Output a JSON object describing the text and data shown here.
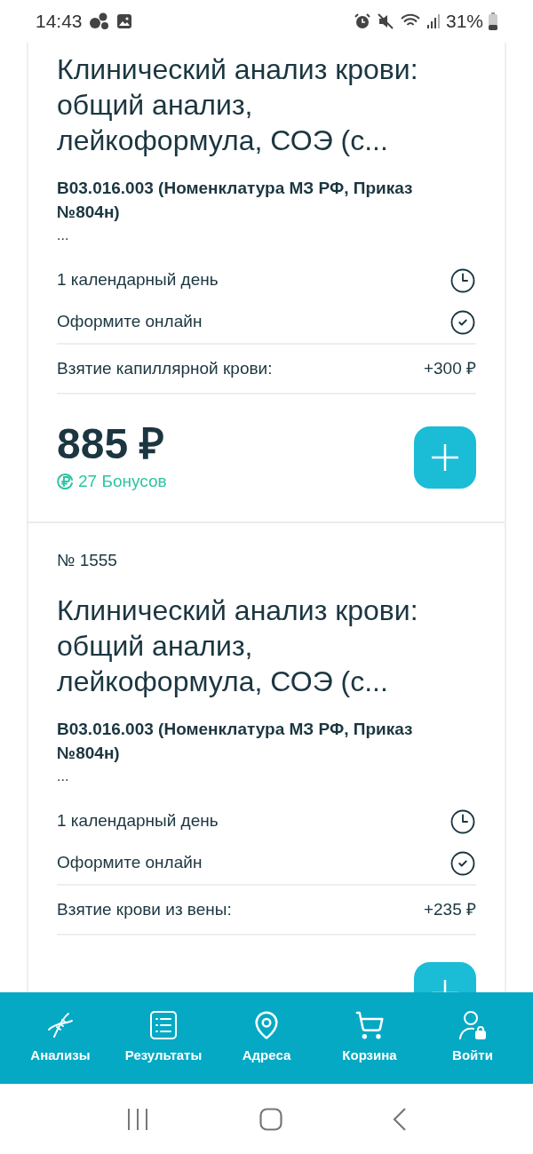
{
  "status_bar": {
    "time": "14:43",
    "battery": "31%"
  },
  "cards": [
    {
      "title": "Клинический анализ крови: общий анализ, лейкоформула, СОЭ (с...",
      "code": "B03.016.003 (Номенклатура МЗ РФ, Приказ №804н)",
      "more": "...",
      "info": [
        {
          "kind": "duration",
          "text": "1 календарный день"
        },
        {
          "kind": "online",
          "text": "Оформите онлайн"
        }
      ],
      "extra": {
        "label": "Взятие капиллярной крови:",
        "price": "+300 ₽"
      },
      "price": "885 ₽",
      "bonus": "27 Бонусов"
    },
    {
      "number": "№ 1555",
      "title": "Клинический анализ крови: общий анализ, лейкоформула, СОЭ (с...",
      "code": "B03.016.003 (Номенклатура МЗ РФ, Приказ №804н)",
      "more": "...",
      "info": [
        {
          "kind": "duration",
          "text": "1 календарный день"
        },
        {
          "kind": "online",
          "text": "Оформите онлайн"
        }
      ],
      "extra": {
        "label": "Взятие крови из вены:",
        "price": "+235 ₽"
      }
    }
  ],
  "nav": [
    {
      "kind": "tests",
      "label": "Анализы"
    },
    {
      "kind": "results",
      "label": "Результаты"
    },
    {
      "kind": "addresses",
      "label": "Адреса"
    },
    {
      "kind": "cart",
      "label": "Корзина"
    },
    {
      "kind": "login",
      "label": "Войти"
    }
  ]
}
